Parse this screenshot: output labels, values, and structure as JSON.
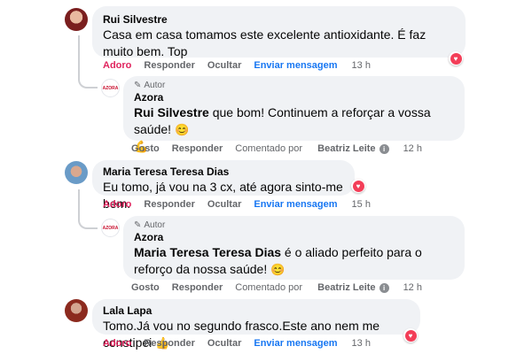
{
  "comments": [
    {
      "author": "Rui Silvestre",
      "text": "Casa em casa tomamos este excelente antioxidante. É faz muito bem. Top",
      "actions": {
        "love": "Adoro",
        "reply": "Responder",
        "hide": "Ocultar",
        "send": "Enviar mensagem",
        "time": "13 h"
      }
    },
    {
      "author": "Maria Teresa Teresa Dias",
      "text": "Eu tomo, já vou na 3 cx, até agora sinto-me bem.",
      "actions": {
        "love": "Adoro",
        "reply": "Responder",
        "hide": "Ocultar",
        "send": "Enviar mensagem",
        "time": "15 h"
      }
    },
    {
      "author": "Lala Lapa",
      "text": "Tomo.Já vou no segundo frasco.Este ano nem me constipei",
      "actions": {
        "love": "Adoro",
        "reply": "Responder",
        "hide": "Ocultar",
        "send": "Enviar mensagem",
        "time": "13 h"
      }
    }
  ],
  "replies": [
    {
      "badge": "Autor",
      "author": "Azora",
      "mention": "Rui Silvestre",
      "text": " que bom! Continuem a reforçar a vossa saúde!",
      "actions": {
        "like": "Gosto",
        "reply": "Responder",
        "commented_by_prefix": "Comentado por",
        "commented_by": "Beatriz Leite",
        "time": "12 h"
      }
    },
    {
      "badge": "Autor",
      "author": "Azora",
      "mention": "Maria Teresa Teresa Dias",
      "text": " é o aliado perfeito para o reforço da nossa saúde!",
      "actions": {
        "like": "Gosto",
        "reply": "Responder",
        "commented_by_prefix": "Comentado por",
        "commented_by": "Beatriz Leite",
        "time": "12 h"
      }
    }
  ],
  "icons": {
    "reaction": "heart-icon",
    "autor_badge": "pencil-icon",
    "info": "info-icon",
    "avatar_logo_text": "AZORA"
  },
  "colors": {
    "bubble": "#f0f2f5",
    "love": "#e0245e",
    "send": "#1877f2",
    "secondary": "#65676b"
  }
}
